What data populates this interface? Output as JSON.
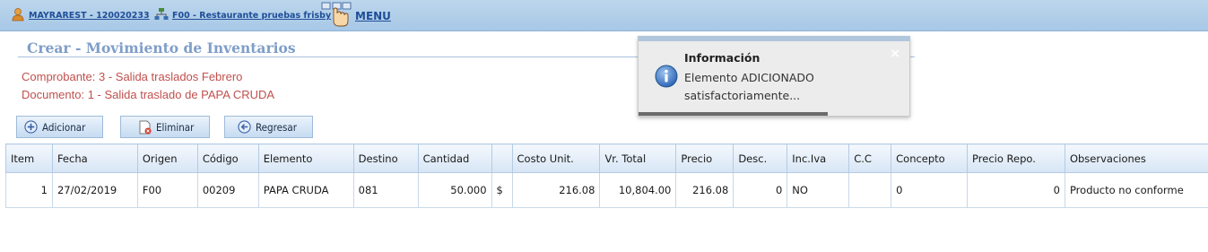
{
  "topbar": {
    "user_link": "MAYRAREST - 120020233",
    "company_link": "F00 - Restaurante pruebas frisby",
    "menu_label": "MENU"
  },
  "page": {
    "title": "Crear - Movimiento de Inventarios",
    "comprobante": "Comprobante: 3 - Salida traslados Febrero",
    "documento": "Documento: 1 - Salida traslado de PAPA CRUDA"
  },
  "toolbar": {
    "add_label": "Adicionar",
    "delete_label": "Eliminar",
    "back_label": "Regresar"
  },
  "table": {
    "headers": [
      "Item",
      "Fecha",
      "Origen",
      "Código",
      "Elemento",
      "Destino",
      "Cantidad",
      "",
      "Costo Unit.",
      "Vr. Total",
      "Precio",
      "Desc.",
      "Inc.Iva",
      "C.C",
      "Concepto",
      "Precio Repo.",
      "Observaciones"
    ],
    "rows": [
      [
        "1",
        "27/02/2019",
        "F00",
        "00209",
        "PAPA CRUDA",
        "081",
        "50.000",
        "$",
        "216.08",
        "10,804.00",
        "216.08",
        "0",
        "NO",
        "",
        "0",
        "0",
        "Producto no conforme"
      ]
    ]
  },
  "notification": {
    "title": "Información",
    "message": "Elemento ADICIONADO satisfactoriamente...",
    "close_symbol": "×",
    "progress": 0.7
  },
  "colors": {
    "topbar": "#a8c8e6",
    "link": "#1f4e98",
    "title": "#7f9ec8",
    "info_text": "#c0504d"
  }
}
